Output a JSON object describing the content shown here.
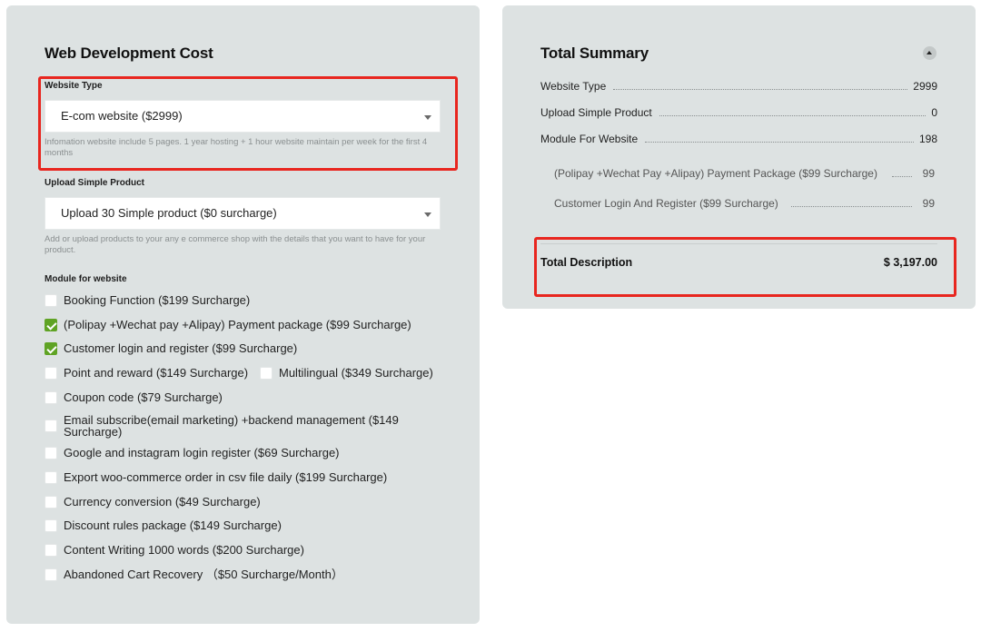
{
  "calculator": {
    "title": "Web Development Cost",
    "website_type": {
      "label": "Website Type",
      "value": "E-com website ($2999)",
      "help": "Infomation website include 5 pages. 1 year hosting + 1 hour website maintain per week for the first 4 months"
    },
    "upload_product": {
      "label": "Upload Simple Product",
      "value": "Upload 30 Simple product ($0 surcharge)",
      "help": "Add or upload products to your any e commerce shop with the details that you want to have for your product."
    },
    "modules": {
      "label": "Module for website",
      "items": [
        {
          "label": "Booking Function ($199 Surcharge)",
          "checked": false
        },
        {
          "label": "(Polipay +Wechat pay +Alipay) Payment package ($99 Surcharge)",
          "checked": true
        },
        {
          "label": "Customer login and register ($99 Surcharge)",
          "checked": true
        },
        {
          "label": "Point and reward ($149 Surcharge)",
          "checked": false
        },
        {
          "label": "Multilingual ($349 Surcharge)",
          "checked": false
        },
        {
          "label": "Coupon code ($79 Surcharge)",
          "checked": false
        },
        {
          "label": "Email subscribe(email marketing) +backend management ($149 Surcharge)",
          "checked": false
        },
        {
          "label": "Google and instagram login register ($69 Surcharge)",
          "checked": false
        },
        {
          "label": "Export woo-commerce order in csv file daily ($199 Surcharge)",
          "checked": false
        },
        {
          "label": "Currency conversion ($49 Surcharge)",
          "checked": false
        },
        {
          "label": "Discount rules package ($149 Surcharge)",
          "checked": false
        },
        {
          "label": "Content Writing 1000 words ($200 Surcharge)",
          "checked": false
        },
        {
          "label": "Abandoned Cart Recovery （$50 Surcharge/Month）",
          "checked": false
        }
      ]
    }
  },
  "summary": {
    "title": "Total Summary",
    "collapse_icon": "chevron-up-icon",
    "rows": [
      {
        "label": "Website Type",
        "value": "2999"
      },
      {
        "label": "Upload Simple Product",
        "value": "0"
      },
      {
        "label": "Module For Website",
        "value": "198"
      }
    ],
    "sub_rows": [
      {
        "label": "(Polipay +Wechat Pay +Alipay) Payment Package ($99 Surcharge)",
        "value": "99"
      },
      {
        "label": "Customer Login And Register ($99 Surcharge)",
        "value": "99"
      }
    ],
    "total_label": "Total Description",
    "total_value": "$ 3,197.00"
  },
  "colors": {
    "panel": "#dde2e2",
    "highlight": "#e8261f",
    "checkbox_checked": "#5fa324"
  }
}
